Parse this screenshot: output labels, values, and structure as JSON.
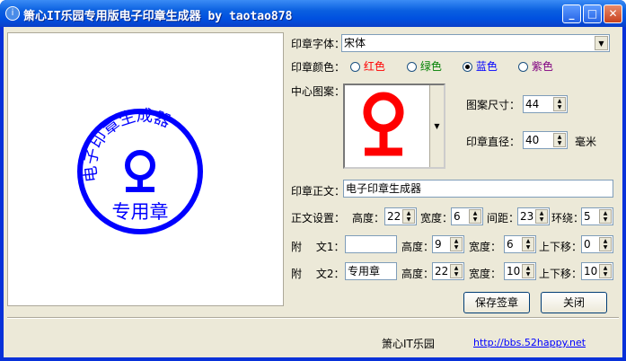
{
  "window": {
    "title": "箫心IT乐园专用版电子印章生成器 by taotao878"
  },
  "stamp": {
    "ring_text": "电子印章生成器",
    "center_text": "专用章",
    "color": "#0000ff",
    "logo_color": "#ff0000"
  },
  "form": {
    "font_label": "印章字体：",
    "font_value": "宋体",
    "color_label": "印章颜色：",
    "colors": [
      {
        "label": "红色",
        "color": "#ff0000"
      },
      {
        "label": "绿色",
        "color": "#008000"
      },
      {
        "label": "蓝色",
        "color": "#0000ff"
      },
      {
        "label": "紫色",
        "color": "#800080"
      }
    ],
    "selected_color": "蓝色",
    "pattern_label": "中心图案：",
    "pattern_size_label": "图案尺寸：",
    "pattern_size": "44",
    "diameter_label": "印章直径：",
    "diameter": "40",
    "diameter_unit": "毫米",
    "main_text_label": "印章正文：",
    "main_text": "电子印章生成器",
    "text_settings_label": "正文设置：",
    "height_label": "高度：",
    "height": "22",
    "width_label": "宽度：",
    "width": "6",
    "spacing_label": "间距：",
    "spacing": "23",
    "wrap_label": "环绕：",
    "wrap": "5",
    "sub1_label": "附　 文1：",
    "sub1": "",
    "sub1_height": "9",
    "sub1_width": "6",
    "sub1_offset": "0",
    "offset_label": "上下移：",
    "sub2_label": "附　 文2：",
    "sub2": "专用章",
    "sub2_height": "22",
    "sub2_width": "10",
    "sub2_offset": "10"
  },
  "buttons": {
    "save": "保存签章",
    "close": "关闭"
  },
  "footer": {
    "site": "箫心IT乐园",
    "link": "http://bbs.52happy.net"
  }
}
